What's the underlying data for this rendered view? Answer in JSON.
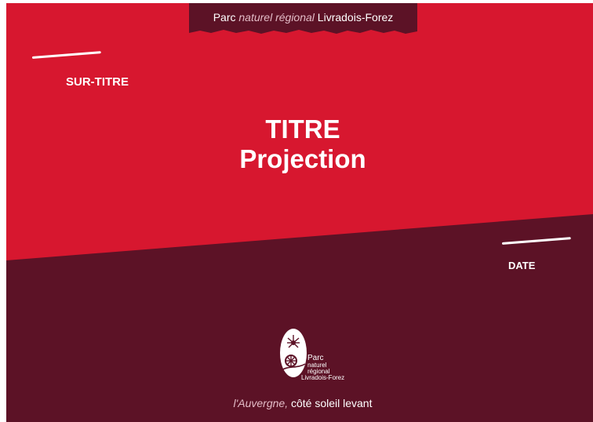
{
  "colors": {
    "red": "#d7172f",
    "bordeaux": "#5c1226",
    "white": "#ffffff"
  },
  "header": {
    "parc": "Parc",
    "naturel_regional": "naturel régional",
    "name": "Livradois-Forez"
  },
  "slide": {
    "surtitle": "SUR-TITRE",
    "title": "TITRE",
    "subtitle": "Projection",
    "date": "DATE"
  },
  "logo": {
    "line1": "Parc",
    "line2": "naturel",
    "line3": "régional",
    "line4": "Livradois-Forez"
  },
  "tagline": {
    "part1": "l'Auvergne,",
    "part2": "côté soleil levant"
  }
}
